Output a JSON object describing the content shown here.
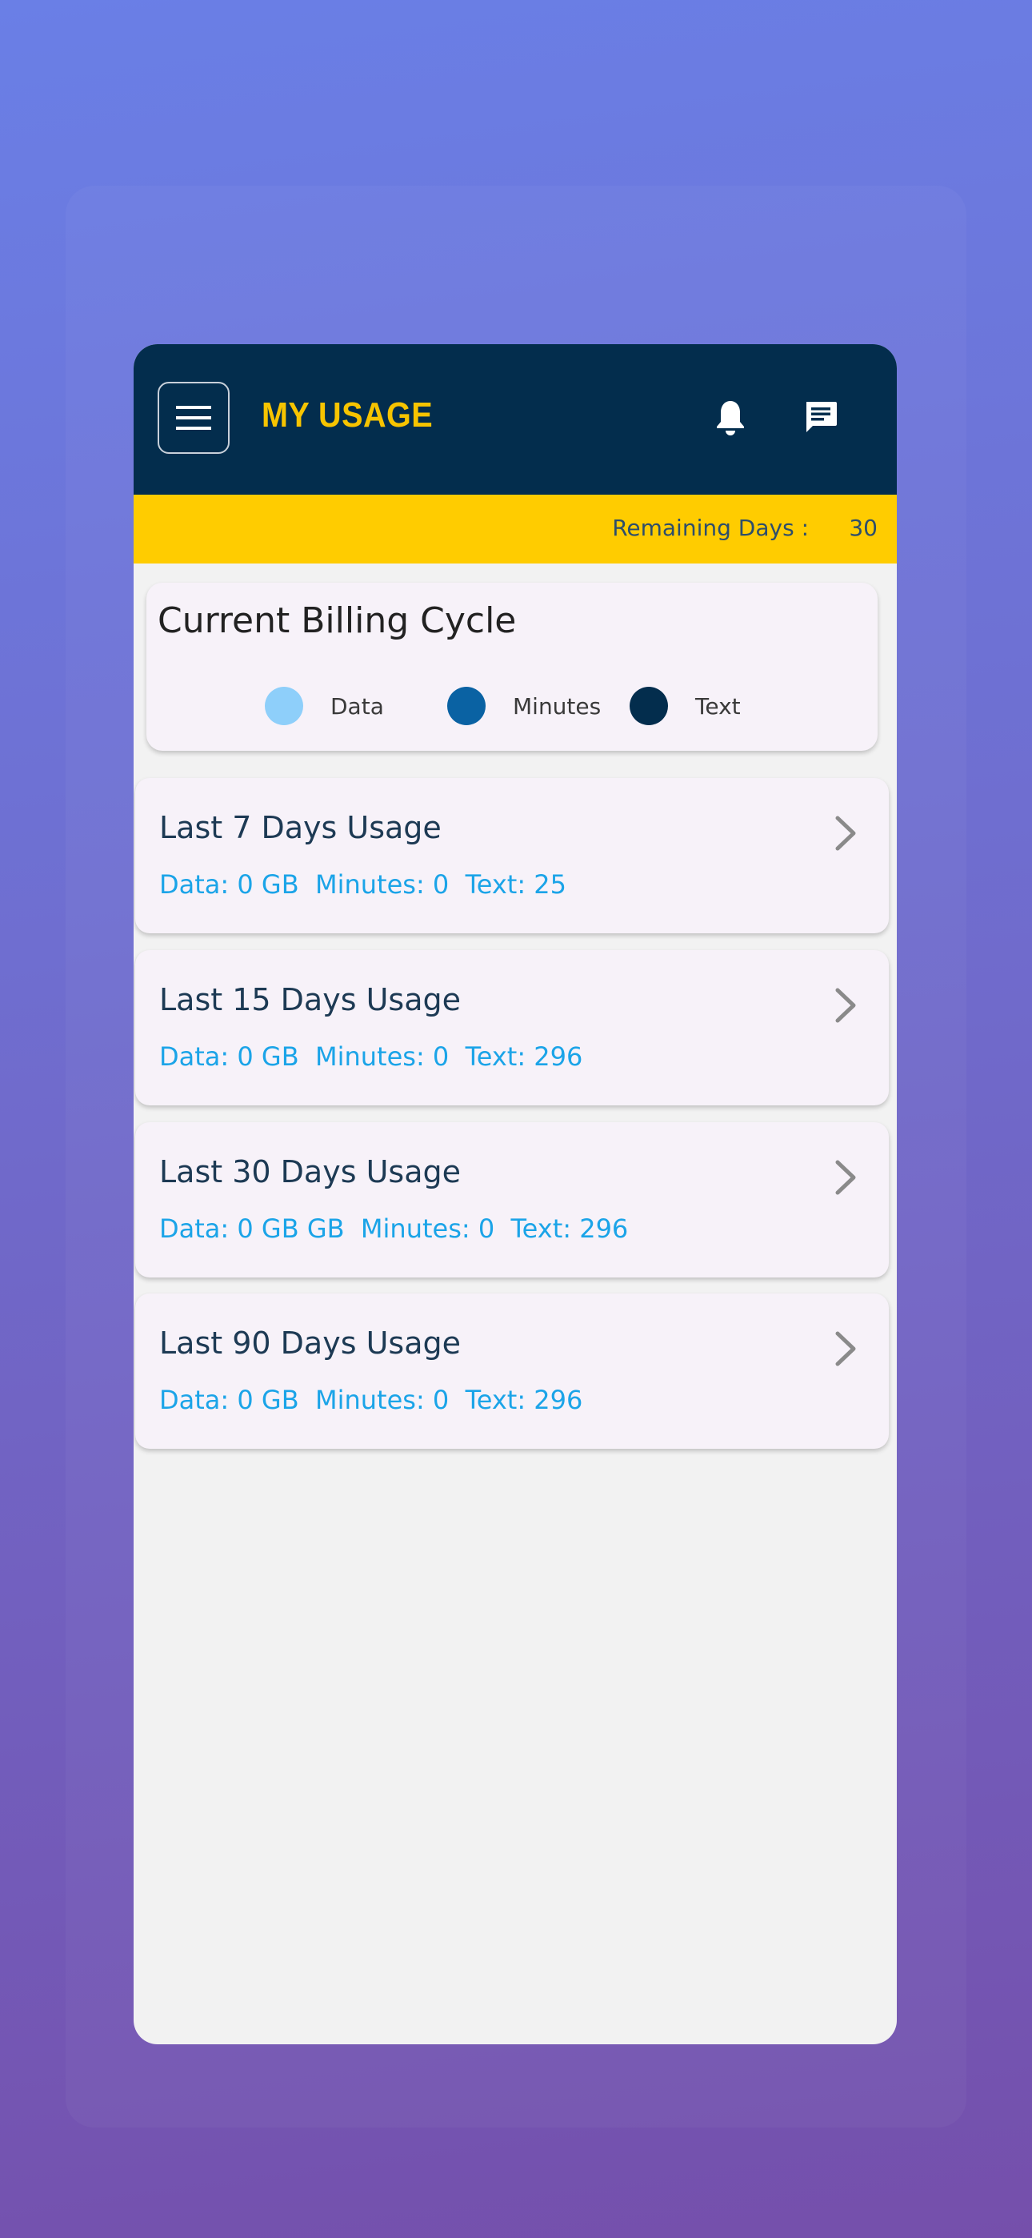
{
  "header": {
    "title": "MY USAGE",
    "menu_icon": "menu-icon",
    "bell_icon": "bell-icon",
    "chat_icon": "chat-icon"
  },
  "remaining": {
    "label": "Remaining Days :",
    "value": "30"
  },
  "billing": {
    "title": "Current Billing Cycle",
    "legend": [
      {
        "label": "Data",
        "color": "#8ecffa"
      },
      {
        "label": "Minutes",
        "color": "#0a62a3"
      },
      {
        "label": "Text",
        "color": "#032d4d"
      }
    ]
  },
  "usage": [
    {
      "title": "Last 7 Days Usage",
      "data": "Data: 0 GB",
      "minutes": "Minutes: 0",
      "text": "Text: 25"
    },
    {
      "title": "Last 15 Days Usage",
      "data": "Data: 0 GB",
      "minutes": "Minutes: 0",
      "text": "Text: 296"
    },
    {
      "title": "Last 30 Days Usage",
      "data": "Data: 0 GB GB",
      "minutes": "Minutes: 0",
      "text": "Text: 296"
    },
    {
      "title": "Last 90 Days Usage",
      "data": "Data: 0 GB",
      "minutes": "Minutes: 0",
      "text": "Text: 296"
    }
  ],
  "colors": {
    "appbar": "#032d4d",
    "accent": "#ffcc00",
    "usage_text": "#1ba4e8"
  }
}
